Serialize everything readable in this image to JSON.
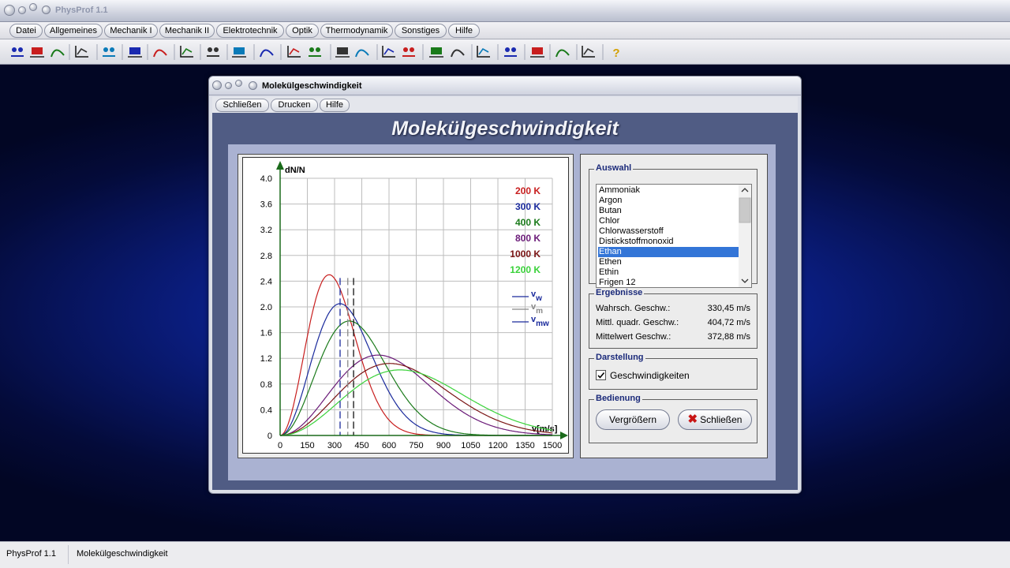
{
  "app": {
    "title": "PhysProf 1.1",
    "menu": [
      "Datei",
      "Allgemeines",
      "Mechanik I",
      "Mechanik II",
      "Elektrotechnik",
      "Optik",
      "Thermodynamik",
      "Sonstiges",
      "Hilfe"
    ]
  },
  "toolbar": {
    "icons": [
      "orbit-icon",
      "conveyor-icon",
      "exchange-icon",
      "hill-icon",
      "container-icon",
      "pump-icon",
      "graph-icon",
      "eye-icon",
      "dots-icon",
      "wave-icon",
      "gender-icon",
      "block-icon",
      "tilt-icon",
      "pendulum-icon",
      "curve-icon",
      "scale-icon",
      "frame-icon",
      "magnet-icon",
      "circuit-icon",
      "component-icon",
      "lens-icon",
      "spectrum-icon",
      "decay-icon",
      "distribution-icon",
      "help-icon"
    ]
  },
  "status": {
    "app": "PhysProf 1.1",
    "module": "Molekülgeschwindigkeit"
  },
  "dialog": {
    "title": "Molekülgeschwindigkeit",
    "menu": [
      "Schließen",
      "Drucken",
      "Hilfe"
    ],
    "heading": "Molekülgeschwindigkeit",
    "selection": {
      "title": "Auswahl",
      "items": [
        "Ammoniak",
        "Argon",
        "Butan",
        "Chlor",
        "Chlorwasserstoff",
        "Distickstoffmonoxid",
        "Ethan",
        "Ethen",
        "Ethin",
        "Frigen 12"
      ],
      "selected": "Ethan"
    },
    "results": {
      "title": "Ergebnisse",
      "rows": [
        {
          "label": "Wahrsch. Geschw.:",
          "value": "330,45 m/s"
        },
        {
          "label": "Mittl. quadr. Geschw.:",
          "value": "404,72 m/s"
        },
        {
          "label": "Mittelwert Geschw.:",
          "value": "372,88 m/s"
        }
      ]
    },
    "display": {
      "title": "Darstellung",
      "checkbox_label": "Geschwindigkeiten",
      "checked": true
    },
    "controls": {
      "title": "Bedienung",
      "zoom_label": "Vergrößern",
      "close_label": "Schließen"
    }
  },
  "chart_data": {
    "type": "line",
    "ylabel": "dN/N",
    "xlabel": "v[m/s]",
    "xlim": [
      0,
      1500
    ],
    "ylim": [
      0,
      4.0
    ],
    "x_ticks": [
      "0",
      "150",
      "300",
      "450",
      "600",
      "750",
      "900",
      "1050",
      "1200",
      "1350",
      "1500"
    ],
    "y_ticks": [
      "0",
      "0.4",
      "0.8",
      "1.2",
      "1.6",
      "2.0",
      "2.4",
      "2.8",
      "3.2",
      "3.6",
      "4.0"
    ],
    "grid": true,
    "series": [
      {
        "name": "200 K",
        "color": "#c81e1e",
        "peak_v": 270,
        "peak_y": 2.5
      },
      {
        "name": "300 K",
        "color": "#1a2a9c",
        "peak_v": 330,
        "peak_y": 2.05
      },
      {
        "name": "400 K",
        "color": "#1a7a1a",
        "peak_v": 381,
        "peak_y": 1.78
      },
      {
        "name": "800 K",
        "color": "#6a1a78",
        "peak_v": 540,
        "peak_y": 1.25
      },
      {
        "name": "1000 K",
        "color": "#7a1414",
        "peak_v": 604,
        "peak_y": 1.12
      },
      {
        "name": "1200 K",
        "color": "#3ad23a",
        "peak_v": 661,
        "peak_y": 1.02
      }
    ],
    "markers": [
      {
        "name": "v_w",
        "value": 330.45,
        "color": "#1a2a9c"
      },
      {
        "name": "v_m",
        "value": 372.88,
        "color": "#888888"
      },
      {
        "name": "v_mw",
        "value": 404.72,
        "color": "#111111"
      }
    ],
    "marker_legend": [
      {
        "sym": "v",
        "sub": "w",
        "color": "#1a2a9c"
      },
      {
        "sym": "v",
        "sub": "m",
        "color": "#888888"
      },
      {
        "sym": "v",
        "sub": "mw",
        "color": "#1a2a9c"
      }
    ]
  }
}
